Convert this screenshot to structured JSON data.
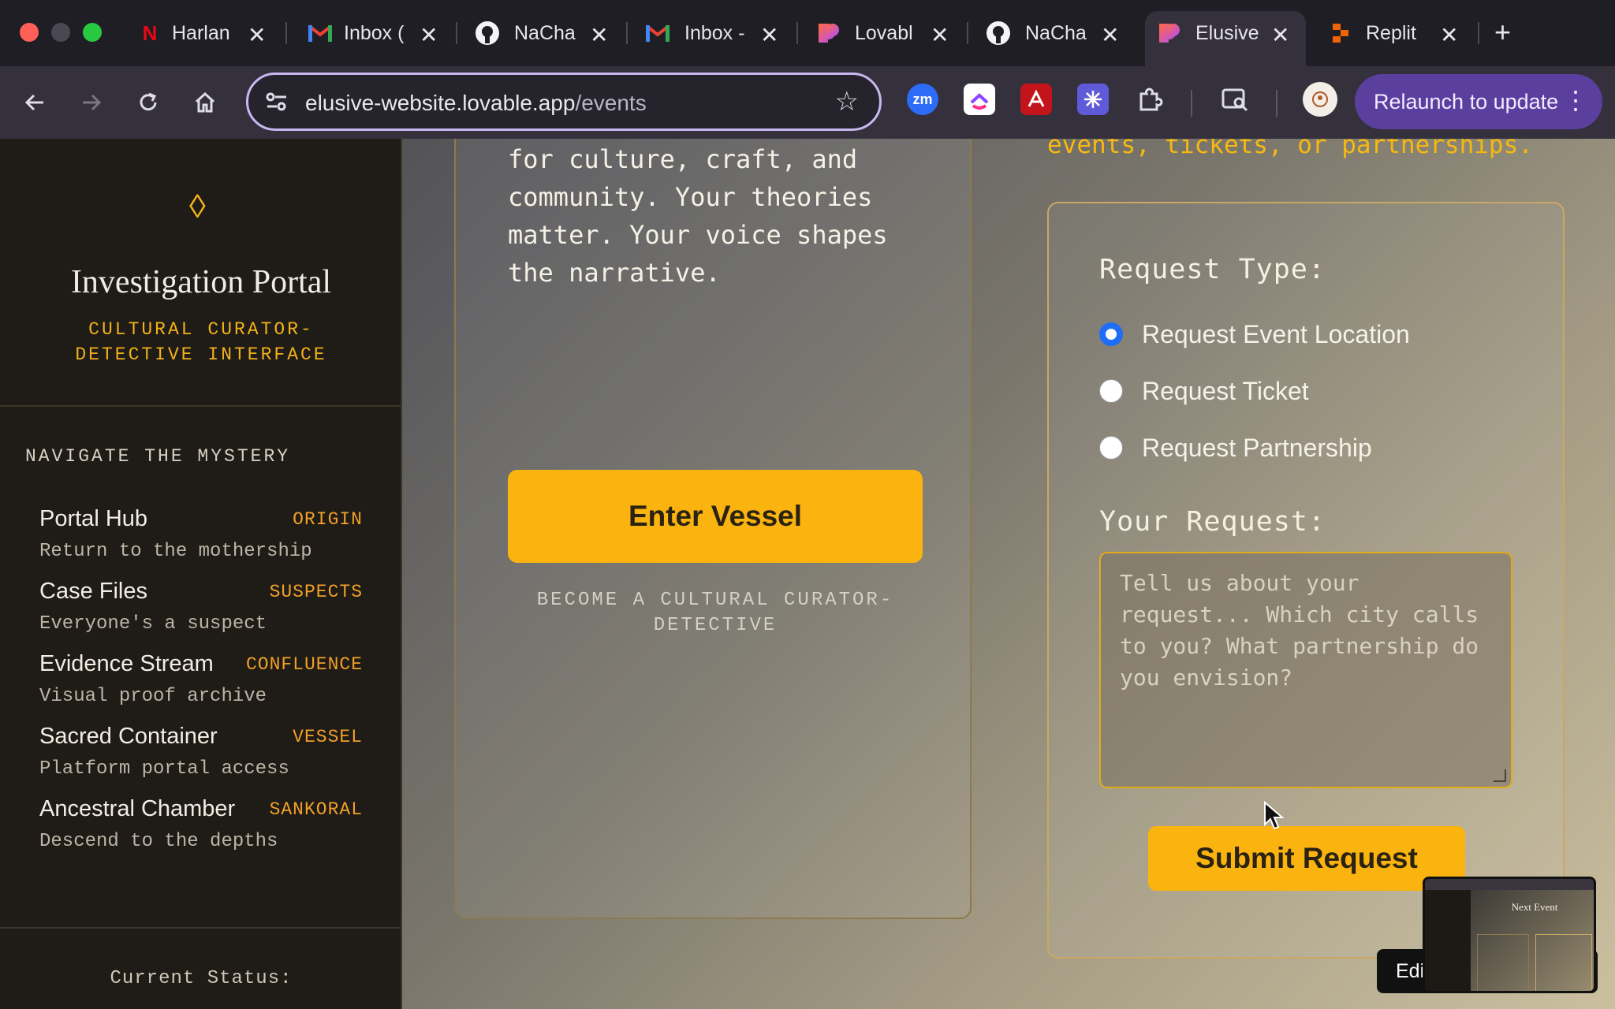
{
  "browser": {
    "tabs": [
      {
        "title": "Harlan",
        "icon": "netflix-icon"
      },
      {
        "title": "Inbox (",
        "icon": "gmail-icon"
      },
      {
        "title": "NaCha",
        "icon": "github-icon"
      },
      {
        "title": "Inbox -",
        "icon": "gmail-icon"
      },
      {
        "title": "Lovabl",
        "icon": "lovable-icon"
      },
      {
        "title": "NaCha",
        "icon": "github-icon"
      },
      {
        "title": "Elusive",
        "icon": "lovable-icon",
        "active": true
      },
      {
        "title": "Replit",
        "icon": "replit-icon"
      }
    ],
    "url_host": "elusive-website.lovable.app",
    "url_path": "/events",
    "relaunch_label": "Relaunch to update",
    "extensions": [
      "zoom-icon",
      "clickup-icon",
      "acrobat-icon",
      "perplexity-icon",
      "puzzle-icon"
    ]
  },
  "sidebar": {
    "title": "Investigation Portal",
    "subtitle": "CULTURAL CURATOR-DETECTIVE INTERFACE",
    "nav_heading": "NAVIGATE THE MYSTERY",
    "items": [
      {
        "label": "Portal Hub",
        "tag": "ORIGIN",
        "desc": "Return to the mothership"
      },
      {
        "label": "Case Files",
        "tag": "SUSPECTS",
        "desc": "Everyone's a suspect"
      },
      {
        "label": "Evidence Stream",
        "tag": "CONFLUENCE",
        "desc": "Visual proof archive"
      },
      {
        "label": "Sacred Container",
        "tag": "VESSEL",
        "desc": "Platform portal access"
      },
      {
        "label": "Ancestral Chamber",
        "tag": "SANKORAL",
        "desc": "Descend to the depths"
      }
    ],
    "status_label": "Current Status:"
  },
  "left_card": {
    "body": "for culture, craft, and community. Your theories matter. Your voice shapes the narrative.",
    "button": "Enter Vessel",
    "caption": "BECOME A CULTURAL CURATOR-DETECTIVE"
  },
  "right_card": {
    "top_text": "events, tickets, or partnerships.",
    "request_type_label": "Request Type:",
    "options": [
      {
        "label": "Request Event Location",
        "selected": true
      },
      {
        "label": "Request Ticket",
        "selected": false
      },
      {
        "label": "Request Partnership",
        "selected": false
      }
    ],
    "your_request_label": "Your Request:",
    "placeholder": "Tell us about your request... Which city calls to you? What partnership do you envision?",
    "submit": "Submit Request"
  },
  "overlay": {
    "edit_label": "Edi",
    "preview_title": "Next Event"
  },
  "colors": {
    "accent": "#fbb40f",
    "sidebar_bg": "#1f1b17",
    "tag": "#f0a028",
    "radio_selected": "#1d6ef5",
    "relaunch_bg": "#5b3f9e"
  }
}
